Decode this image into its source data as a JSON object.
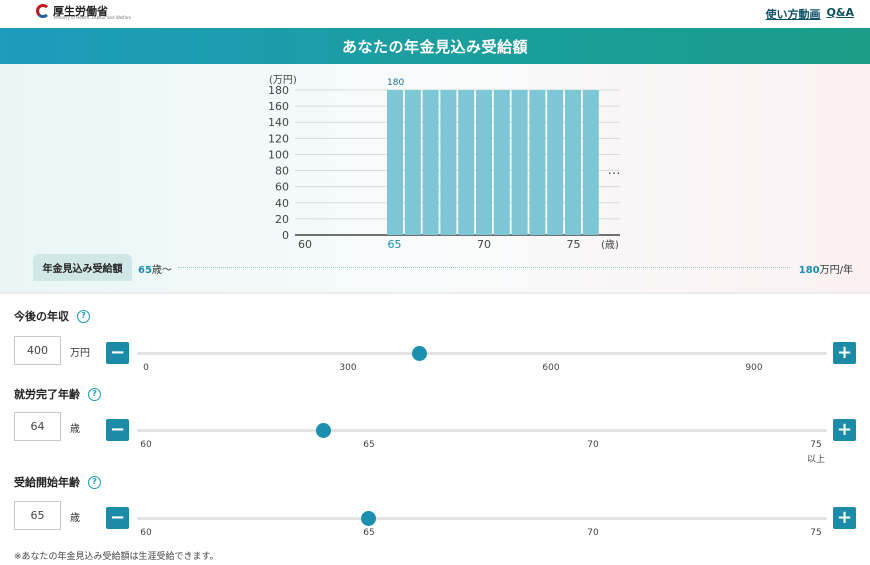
{
  "header": {
    "logo_text": "厚生労働省",
    "logo_subtext": "Ministry of Health, Labour and Welfare",
    "link_video": "使い方動画",
    "link_qa": "Q&A"
  },
  "title": "あなたの年金見込み受給額",
  "chart_data": {
    "type": "bar",
    "ylabel": "(万円)",
    "xlabel": "(歳)",
    "yticks": [
      0,
      20,
      40,
      60,
      80,
      100,
      120,
      140,
      160,
      180
    ],
    "ylim": [
      0,
      180
    ],
    "xlim": [
      60,
      77
    ],
    "xticks": [
      60,
      65,
      70,
      75
    ],
    "highlight_tick": 65,
    "bars": [
      {
        "age": 65,
        "value": 180
      },
      {
        "age": 66,
        "value": 180
      },
      {
        "age": 67,
        "value": 180
      },
      {
        "age": 68,
        "value": 180
      },
      {
        "age": 69,
        "value": 180
      },
      {
        "age": 70,
        "value": 180
      },
      {
        "age": 71,
        "value": 180
      },
      {
        "age": 72,
        "value": 180
      },
      {
        "age": 73,
        "value": 180
      },
      {
        "age": 74,
        "value": 180
      },
      {
        "age": 75,
        "value": 180
      },
      {
        "age": 76,
        "value": 180
      }
    ],
    "data_label": "180",
    "continuation_marker": "…",
    "bar_color": "#7cc6d6"
  },
  "summary": {
    "label": "年金見込み受給額",
    "age_value": "65",
    "age_suffix": "歳〜",
    "amount_value": "180",
    "amount_suffix": "万円/年"
  },
  "controls": {
    "income": {
      "title": "今後の年収",
      "value": "400",
      "unit": "万円",
      "ticks": [
        "0",
        "300",
        "600",
        "900"
      ],
      "fraction": 0.41
    },
    "retire_age": {
      "title": "就労完了年齢",
      "value": "64",
      "unit": "歳",
      "ticks": [
        "60",
        "65",
        "70",
        "75"
      ],
      "last_tick_sub": "以上",
      "fraction": 0.27
    },
    "start_age": {
      "title": "受給開始年齢",
      "value": "65",
      "unit": "歳",
      "ticks": [
        "60",
        "65",
        "70",
        "75"
      ],
      "fraction": 0.335
    }
  },
  "note": "※あなたの年金見込み受給額は生涯受給できます。",
  "help_glyph": "?",
  "minus_glyph": "−",
  "plus_glyph": "+",
  "colors": {
    "accent": "#1a8fb0",
    "button": "#1a8ca8"
  }
}
